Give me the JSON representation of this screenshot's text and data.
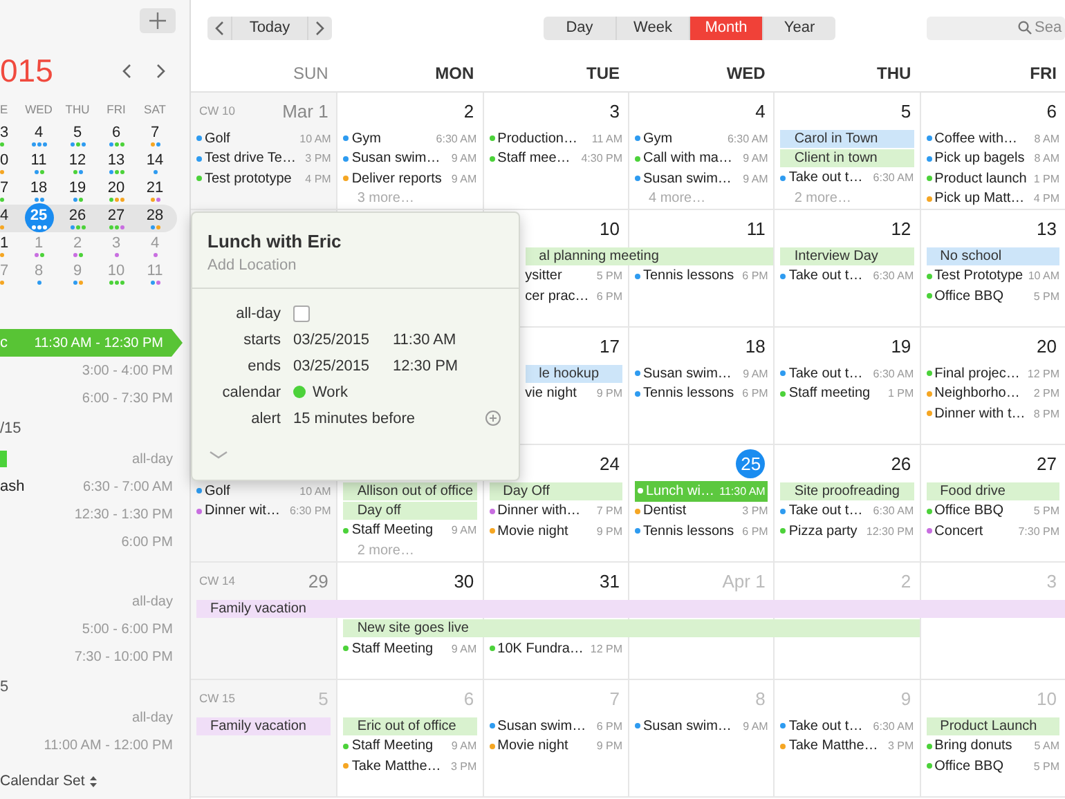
{
  "sidebar": {
    "mini_calendar": {
      "title": "015",
      "weekdays": [
        "E",
        "WED",
        "THU",
        "FRI",
        "SAT"
      ],
      "weeks": [
        {
          "selected": false,
          "days": [
            {
              "day": "3",
              "other_month": false,
              "today": false,
              "dots": [
                {
                  "color": "#4cd23a"
                }
              ]
            },
            {
              "day": "4",
              "other_month": false,
              "today": false,
              "dots": [
                {
                  "color": "#2e9bf0"
                },
                {
                  "color": "#2e9bf0"
                },
                {
                  "color": "#2e9bf0"
                }
              ]
            },
            {
              "day": "5",
              "other_month": false,
              "today": false,
              "dots": [
                {
                  "color": "#2e9bf0"
                },
                {
                  "color": "#4cd23a"
                },
                {
                  "color": "#2e9bf0"
                }
              ]
            },
            {
              "day": "6",
              "other_month": false,
              "today": false,
              "dots": [
                {
                  "color": "#2e9bf0"
                },
                {
                  "color": "#4cd23a"
                },
                {
                  "color": "#4cd23a"
                }
              ]
            },
            {
              "day": "7",
              "other_month": false,
              "today": false,
              "dots": [
                {
                  "color": "#f5a623"
                },
                {
                  "color": "#2e9bf0"
                }
              ]
            }
          ]
        },
        {
          "selected": false,
          "days": [
            {
              "day": "0",
              "other_month": false,
              "today": false,
              "dots": [
                {
                  "color": "#f5a623"
                }
              ]
            },
            {
              "day": "11",
              "other_month": false,
              "today": false,
              "dots": [
                {
                  "color": "#2e9bf0"
                },
                {
                  "color": "#4cd23a"
                }
              ]
            },
            {
              "day": "12",
              "other_month": false,
              "today": false,
              "dots": [
                {
                  "color": "#4cd23a"
                },
                {
                  "color": "#2e9bf0"
                }
              ]
            },
            {
              "day": "13",
              "other_month": false,
              "today": false,
              "dots": [
                {
                  "color": "#2e9bf0"
                },
                {
                  "color": "#4cd23a"
                },
                {
                  "color": "#4cd23a"
                }
              ]
            },
            {
              "day": "14",
              "other_month": false,
              "today": false,
              "dots": [
                {
                  "color": "#2e9bf0"
                }
              ]
            }
          ]
        },
        {
          "selected": false,
          "days": [
            {
              "day": "7",
              "other_month": false,
              "today": false,
              "dots": [
                {
                  "color": "#4cd23a"
                }
              ]
            },
            {
              "day": "18",
              "other_month": false,
              "today": false,
              "dots": [
                {
                  "color": "#2e9bf0"
                },
                {
                  "color": "#2e9bf0"
                }
              ]
            },
            {
              "day": "19",
              "other_month": false,
              "today": false,
              "dots": [
                {
                  "color": "#2e9bf0"
                },
                {
                  "color": "#4cd23a"
                }
              ]
            },
            {
              "day": "20",
              "other_month": false,
              "today": false,
              "dots": [
                {
                  "color": "#4cd23a"
                },
                {
                  "color": "#f5a623"
                },
                {
                  "color": "#f5a623"
                }
              ]
            },
            {
              "day": "21",
              "other_month": false,
              "today": false,
              "dots": [
                {
                  "color": "#f5a623"
                },
                {
                  "color": "#c86ee0"
                }
              ]
            }
          ]
        },
        {
          "selected": true,
          "days": [
            {
              "day": "4",
              "other_month": false,
              "today": false,
              "dots": [
                {
                  "color": "#f5a623"
                }
              ]
            },
            {
              "day": "25",
              "other_month": false,
              "today": true,
              "dots": [
                {
                  "color": "#ffffff"
                },
                {
                  "color": "#ffffff"
                },
                {
                  "color": "#ffffff"
                }
              ]
            },
            {
              "day": "26",
              "other_month": false,
              "today": false,
              "dots": [
                {
                  "color": "#2e9bf0"
                },
                {
                  "color": "#4cd23a"
                },
                {
                  "color": "#4cd23a"
                }
              ]
            },
            {
              "day": "27",
              "other_month": false,
              "today": false,
              "dots": [
                {
                  "color": "#4cd23a"
                },
                {
                  "color": "#4cd23a"
                },
                {
                  "color": "#c86ee0"
                }
              ]
            },
            {
              "day": "28",
              "other_month": false,
              "today": false,
              "dots": [
                {
                  "color": "#2e9bf0"
                },
                {
                  "color": "#f5a623"
                }
              ]
            }
          ]
        },
        {
          "selected": false,
          "days": [
            {
              "day": "1",
              "other_month": false,
              "today": false,
              "dots": [
                {
                  "color": "#f5a623"
                }
              ]
            },
            {
              "day": "1",
              "other_month": true,
              "today": false,
              "dots": [
                {
                  "color": "#c86ee0"
                },
                {
                  "color": "#4cd23a"
                }
              ]
            },
            {
              "day": "2",
              "other_month": true,
              "today": false,
              "dots": [
                {
                  "color": "#c86ee0"
                },
                {
                  "color": "#4cd23a"
                }
              ]
            },
            {
              "day": "3",
              "other_month": true,
              "today": false,
              "dots": [
                {
                  "color": "#c86ee0"
                }
              ]
            },
            {
              "day": "4",
              "other_month": true,
              "today": false,
              "dots": [
                {
                  "color": "#c86ee0"
                }
              ]
            }
          ]
        },
        {
          "selected": false,
          "days": [
            {
              "day": "7",
              "other_month": true,
              "today": false,
              "dots": [
                {
                  "color": "#f5a623"
                }
              ]
            },
            {
              "day": "8",
              "other_month": true,
              "today": false,
              "dots": [
                {
                  "color": "#2e9bf0"
                }
              ]
            },
            {
              "day": "9",
              "other_month": true,
              "today": false,
              "dots": [
                {
                  "color": "#2e9bf0"
                },
                {
                  "color": "#f5a623"
                }
              ]
            },
            {
              "day": "10",
              "other_month": true,
              "today": false,
              "dots": [
                {
                  "color": "#4cd23a"
                },
                {
                  "color": "#4cd23a"
                },
                {
                  "color": "#4cd23a"
                }
              ]
            },
            {
              "day": "11",
              "other_month": true,
              "today": false,
              "dots": [
                {
                  "color": "#2e9bf0"
                },
                {
                  "color": "#c86ee0"
                }
              ]
            }
          ]
        }
      ]
    },
    "agenda": [
      {
        "kind": "event",
        "title": "c",
        "time": "11:30 AM - 12:30 PM",
        "selected": true
      },
      {
        "kind": "event",
        "time": "3:00 - 4:00 PM",
        "selected": false
      },
      {
        "kind": "event",
        "time": "6:00 - 7:30 PM",
        "selected": false
      },
      {
        "kind": "heading",
        "text": "/15"
      },
      {
        "kind": "event",
        "time": "all-day",
        "color": "#4cd23a",
        "selected": false
      },
      {
        "kind": "event",
        "title": "ash",
        "time": "6:30 - 7:00 AM",
        "selected": false
      },
      {
        "kind": "event",
        "time": "12:30 - 1:30 PM",
        "selected": false
      },
      {
        "kind": "event",
        "time": "6:00 PM",
        "selected": false
      },
      {
        "kind": "spacer"
      },
      {
        "kind": "event",
        "time": "all-day",
        "selected": false
      },
      {
        "kind": "event",
        "time": "5:00 - 6:00 PM",
        "selected": false
      },
      {
        "kind": "event",
        "time": "7:30 - 10:00 PM",
        "selected": false
      },
      {
        "kind": "heading",
        "text": "5"
      },
      {
        "kind": "event",
        "time": "all-day",
        "selected": false
      },
      {
        "kind": "event",
        "time": "11:00 AM - 12:00 PM",
        "selected": false
      }
    ],
    "calendar_set": "Calendar Set"
  },
  "toolbar": {
    "today": "Today",
    "views": [
      {
        "label": "Day",
        "selected": false
      },
      {
        "label": "Week",
        "selected": false
      },
      {
        "label": "Month",
        "selected": true
      },
      {
        "label": "Year",
        "selected": false
      }
    ],
    "search": {
      "placeholder": "Sea"
    }
  },
  "month": {
    "weekdays": [
      {
        "label": "SUN",
        "weekend": true
      },
      {
        "label": "MON",
        "weekend": false
      },
      {
        "label": "TUE",
        "weekend": false
      },
      {
        "label": "WED",
        "weekend": false
      },
      {
        "label": "THU",
        "weekend": false
      },
      {
        "label": "FRI",
        "weekend": false
      }
    ],
    "weeks": [
      {
        "cells": [
          {
            "week_label": "CW 10",
            "day": "Mar 1",
            "other_month": false,
            "today": false,
            "items": [
              {
                "kind": "event",
                "title": "Golf",
                "time": "10 AM",
                "color": "#2e9bf0",
                "selected": false
              },
              {
                "kind": "event",
                "title": "Test drive Te…",
                "time": "3 PM",
                "color": "#2e9bf0",
                "selected": false
              },
              {
                "kind": "event",
                "title": "Test prototype",
                "time": "4 PM",
                "color": "#4cd23a",
                "selected": false
              }
            ]
          },
          {
            "day": "2",
            "other_month": false,
            "today": false,
            "items": [
              {
                "kind": "event",
                "title": "Gym",
                "time": "6:30 AM",
                "color": "#2e9bf0",
                "selected": false
              },
              {
                "kind": "event",
                "title": "Susan swim…",
                "time": "9 AM",
                "color": "#2e9bf0",
                "selected": false
              },
              {
                "kind": "event",
                "title": "Deliver reports",
                "time": "9 AM",
                "color": "#f5a623",
                "selected": false
              },
              {
                "kind": "more",
                "text": "3 more…"
              }
            ]
          },
          {
            "day": "3",
            "other_month": false,
            "today": false,
            "items": [
              {
                "kind": "event",
                "title": "Production…",
                "time": "11 AM",
                "color": "#4cd23a",
                "selected": false
              },
              {
                "kind": "event",
                "title": "Staff mee…",
                "time": "4:30 PM",
                "color": "#4cd23a",
                "selected": false
              }
            ]
          },
          {
            "day": "4",
            "other_month": false,
            "today": false,
            "items": [
              {
                "kind": "event",
                "title": "Gym",
                "time": "6:30 AM",
                "color": "#2e9bf0",
                "selected": false
              },
              {
                "kind": "event",
                "title": "Call with ma…",
                "time": "9 AM",
                "color": "#4cd23a",
                "selected": false
              },
              {
                "kind": "event",
                "title": "Susan swim…",
                "time": "9 AM",
                "color": "#2e9bf0",
                "selected": false
              },
              {
                "kind": "more",
                "text": "4 more…"
              }
            ]
          },
          {
            "day": "5",
            "other_month": false,
            "today": false,
            "items": [
              {
                "kind": "band",
                "title": "Carol in Town",
                "color": "#cde5f9",
                "selected": false
              },
              {
                "kind": "band",
                "title": "Client in town",
                "color": "#d9f2cf",
                "selected": false
              },
              {
                "kind": "event",
                "title": "Take out t…",
                "time": "6:30 AM",
                "color": "#2e9bf0",
                "selected": false
              },
              {
                "kind": "more",
                "text": "2 more…"
              }
            ]
          },
          {
            "day": "6",
            "other_month": false,
            "today": false,
            "items": [
              {
                "kind": "event",
                "title": "Coffee with…",
                "time": "8 AM",
                "color": "#2e9bf0",
                "selected": false
              },
              {
                "kind": "event",
                "title": "Pick up bagels",
                "time": "8 AM",
                "color": "#2e9bf0",
                "selected": false
              },
              {
                "kind": "event",
                "title": "Product launch",
                "time": "1 PM",
                "color": "#4cd23a",
                "selected": false
              },
              {
                "kind": "event",
                "title": "Pick up Matt…",
                "time": "4 PM",
                "color": "#f5a623",
                "selected": false
              }
            ]
          }
        ]
      },
      {
        "cells": [
          {},
          {},
          {
            "day": "10",
            "other_month": false,
            "today": false,
            "under_popover": true,
            "items": [
              {
                "kind": "band",
                "title": "al planning meeting",
                "color": "#d9f2cf",
                "selected": false
              },
              {
                "kind": "event",
                "title": "ysitter",
                "time": "5 PM",
                "selected": false
              },
              {
                "kind": "event",
                "title": "cer prac…",
                "time": "6 PM",
                "selected": false
              }
            ]
          },
          {
            "day": "11",
            "other_month": false,
            "today": false,
            "items": [
              {
                "kind": "continued"
              },
              {
                "kind": "event",
                "title": "Tennis lessons",
                "time": "6 PM",
                "color": "#2e9bf0",
                "selected": false
              }
            ]
          },
          {
            "day": "12",
            "other_month": false,
            "today": false,
            "items": [
              {
                "kind": "band",
                "title": "Interview Day",
                "color": "#d9f2cf",
                "selected": false
              },
              {
                "kind": "event",
                "title": "Take out t…",
                "time": "6:30 AM",
                "color": "#2e9bf0",
                "selected": false
              }
            ]
          },
          {
            "day": "13",
            "other_month": false,
            "today": false,
            "items": [
              {
                "kind": "band",
                "title": "No school",
                "color": "#cde5f9",
                "selected": false
              },
              {
                "kind": "event",
                "title": "Test Prototype",
                "time": "10 AM",
                "color": "#4cd23a",
                "selected": false
              },
              {
                "kind": "event",
                "title": "Office BBQ",
                "time": "5 PM",
                "color": "#4cd23a",
                "selected": false
              }
            ]
          }
        ]
      },
      {
        "cells": [
          {},
          {},
          {
            "day": "17",
            "other_month": false,
            "today": false,
            "under_popover": true,
            "items": [
              {
                "kind": "band",
                "title": "le hookup",
                "color": "#cde5f9",
                "selected": false
              },
              {
                "kind": "event",
                "title": "vie night",
                "time": "9 PM",
                "selected": false
              }
            ]
          },
          {
            "day": "18",
            "other_month": false,
            "today": false,
            "items": [
              {
                "kind": "event",
                "title": "Susan swim…",
                "time": "9 AM",
                "color": "#2e9bf0",
                "selected": false
              },
              {
                "kind": "event",
                "title": "Tennis lessons",
                "time": "6 PM",
                "color": "#2e9bf0",
                "selected": false
              }
            ]
          },
          {
            "day": "19",
            "other_month": false,
            "today": false,
            "items": [
              {
                "kind": "event",
                "title": "Take out t…",
                "time": "6:30 AM",
                "color": "#2e9bf0",
                "selected": false
              },
              {
                "kind": "event",
                "title": "Staff meeting",
                "time": "1 PM",
                "color": "#4cd23a",
                "selected": false
              }
            ]
          },
          {
            "day": "20",
            "other_month": false,
            "today": false,
            "items": [
              {
                "kind": "event",
                "title": "Final projec…",
                "time": "12 PM",
                "color": "#4cd23a",
                "selected": false
              },
              {
                "kind": "event",
                "title": "Neighborho…",
                "time": "2 PM",
                "color": "#f5a623",
                "selected": false
              },
              {
                "kind": "event",
                "title": "Dinner with t…",
                "time": "8 PM",
                "color": "#f5a623",
                "selected": false
              }
            ]
          }
        ]
      },
      {
        "cells": [
          {
            "items": [
              {
                "kind": "event",
                "title": "Golf",
                "time": "10 AM",
                "color": "#2e9bf0",
                "selected": false
              },
              {
                "kind": "event",
                "title": "Dinner wit…",
                "time": "6:30 PM",
                "color": "#c86ee0",
                "selected": false
              }
            ]
          },
          {
            "items": [
              {
                "kind": "band",
                "title": "Allison out of office",
                "color": "#d9f2cf",
                "selected": false
              },
              {
                "kind": "band",
                "title": "Day off",
                "color": "#d9f2cf",
                "selected": false
              },
              {
                "kind": "event",
                "title": "Staff Meeting",
                "time": "9 AM",
                "color": "#4cd23a",
                "selected": false
              },
              {
                "kind": "more",
                "text": "2 more…"
              }
            ]
          },
          {
            "day": "24",
            "other_month": false,
            "today": false,
            "items": [
              {
                "kind": "band",
                "title": "Day Off",
                "color": "#d9f2cf",
                "selected": false
              },
              {
                "kind": "event",
                "title": "Dinner with…",
                "time": "7 PM",
                "color": "#c86ee0",
                "selected": false
              },
              {
                "kind": "event",
                "title": "Movie night",
                "time": "9 PM",
                "color": "#f5a623",
                "selected": false
              }
            ]
          },
          {
            "day": "25",
            "other_month": false,
            "today": true,
            "items": [
              {
                "kind": "event",
                "title": "Lunch wi…",
                "time": "11:30 AM",
                "color": "#5cc83f",
                "selected": true
              },
              {
                "kind": "event",
                "title": "Dentist",
                "time": "3 PM",
                "color": "#f5a623",
                "selected": false
              },
              {
                "kind": "event",
                "title": "Tennis lessons",
                "time": "6 PM",
                "color": "#2e9bf0",
                "selected": false
              }
            ]
          },
          {
            "day": "26",
            "other_month": false,
            "today": false,
            "items": [
              {
                "kind": "band",
                "title": "Site proofreading",
                "color": "#d9f2cf",
                "selected": false
              },
              {
                "kind": "event",
                "title": "Take out t…",
                "time": "6:30 AM",
                "color": "#2e9bf0",
                "selected": false
              },
              {
                "kind": "event",
                "title": "Pizza party",
                "time": "12:30 PM",
                "color": "#4cd23a",
                "selected": false
              }
            ]
          },
          {
            "day": "27",
            "other_month": false,
            "today": false,
            "items": [
              {
                "kind": "band",
                "title": "Food drive",
                "color": "#d9f2cf",
                "selected": false
              },
              {
                "kind": "event",
                "title": "Office BBQ",
                "time": "5 PM",
                "color": "#4cd23a",
                "selected": false
              },
              {
                "kind": "event",
                "title": "Concert",
                "time": "7:30 PM",
                "color": "#c86ee0",
                "selected": false
              }
            ]
          }
        ]
      },
      {
        "cells": [
          {
            "week_label": "CW 14",
            "day": "29",
            "other_month": false,
            "today": false,
            "items": [
              {
                "kind": "band",
                "title": "Family vacation",
                "color": "#f0def7",
                "selected": false
              }
            ]
          },
          {
            "day": "30",
            "other_month": false,
            "today": false,
            "items": [
              {
                "kind": "continued"
              },
              {
                "kind": "band",
                "title": "New site goes live",
                "color": "#d9f2cf",
                "selected": false
              },
              {
                "kind": "event",
                "title": "Staff Meeting",
                "time": "9 AM",
                "color": "#4cd23a",
                "selected": false
              }
            ]
          },
          {
            "day": "31",
            "other_month": false,
            "today": false,
            "items": [
              {
                "kind": "continued"
              },
              {
                "kind": "continued"
              },
              {
                "kind": "event",
                "title": "10K Fundra…",
                "time": "12 PM",
                "color": "#4cd23a",
                "selected": false
              }
            ]
          },
          {
            "day": "Apr 1",
            "other_month": true,
            "today": false,
            "items": [
              {
                "kind": "continued"
              },
              {
                "kind": "continued"
              }
            ]
          },
          {
            "day": "2",
            "other_month": true,
            "today": false,
            "items": [
              {
                "kind": "continued"
              },
              {
                "kind": "continued"
              }
            ]
          },
          {
            "day": "3",
            "other_month": true,
            "today": false,
            "items": [
              {
                "kind": "continued"
              }
            ]
          }
        ]
      },
      {
        "cells": [
          {
            "week_label": "CW 15",
            "day": "5",
            "other_month": true,
            "today": false,
            "items": [
              {
                "kind": "band",
                "title": "Family vacation",
                "color": "#f0def7",
                "selected": false
              }
            ]
          },
          {
            "day": "6",
            "other_month": true,
            "today": false,
            "items": [
              {
                "kind": "band",
                "title": "Eric out of office",
                "color": "#d9f2cf",
                "selected": false
              },
              {
                "kind": "event",
                "title": "Staff Meeting",
                "time": "9 AM",
                "color": "#4cd23a",
                "selected": false
              },
              {
                "kind": "event",
                "title": "Take Matthe…",
                "time": "3 PM",
                "color": "#f5a623",
                "selected": false
              }
            ]
          },
          {
            "day": "7",
            "other_month": true,
            "today": false,
            "items": [
              {
                "kind": "event",
                "title": "Susan swim…",
                "time": "6 PM",
                "color": "#2e9bf0",
                "selected": false
              },
              {
                "kind": "event",
                "title": "Movie night",
                "time": "9 PM",
                "color": "#f5a623",
                "selected": false
              }
            ]
          },
          {
            "day": "8",
            "other_month": true,
            "today": false,
            "items": [
              {
                "kind": "event",
                "title": "Susan swim…",
                "time": "9 AM",
                "color": "#2e9bf0",
                "selected": false
              }
            ]
          },
          {
            "day": "9",
            "other_month": true,
            "today": false,
            "items": [
              {
                "kind": "event",
                "title": "Take out t…",
                "time": "6:30 AM",
                "color": "#2e9bf0",
                "selected": false
              },
              {
                "kind": "event",
                "title": "Take Matthe…",
                "time": "3 PM",
                "color": "#f5a623",
                "selected": false
              }
            ]
          },
          {
            "day": "10",
            "other_month": true,
            "today": false,
            "items": [
              {
                "kind": "band",
                "title": "Product Launch",
                "color": "#d9f2cf",
                "selected": false
              },
              {
                "kind": "event",
                "title": "Bring donuts",
                "time": "5 AM",
                "color": "#4cd23a",
                "selected": false
              },
              {
                "kind": "event",
                "title": "Office BBQ",
                "time": "5 PM",
                "color": "#4cd23a",
                "selected": false
              }
            ]
          }
        ]
      }
    ]
  },
  "popover": {
    "title": "Lunch with Eric",
    "location": {
      "placeholder": "Add Location"
    },
    "fields": [
      {
        "kind": "checkbox",
        "label": "all-day",
        "checked": false
      },
      {
        "kind": "datetime",
        "label": "starts",
        "date": "03/25/2015",
        "time": "11:30 AM"
      },
      {
        "kind": "datetime",
        "label": "ends",
        "date": "03/25/2015",
        "time": "12:30 PM"
      },
      {
        "kind": "calendar",
        "label": "calendar",
        "value": "Work",
        "color": "#4cd23a"
      },
      {
        "kind": "alert",
        "label": "alert",
        "value": "15 minutes before"
      }
    ]
  }
}
